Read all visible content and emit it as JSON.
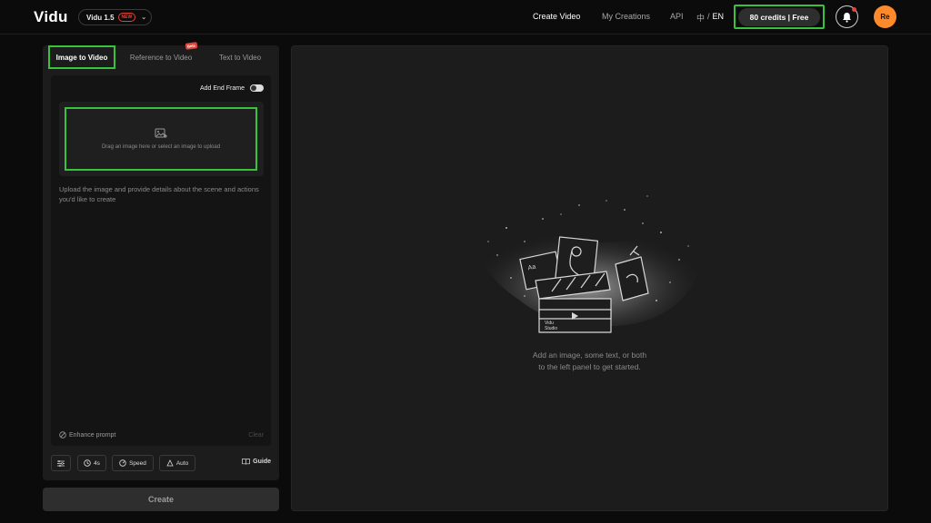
{
  "header": {
    "logo": "Vidu",
    "model": "Vidu 1.5",
    "model_badge": "NEW",
    "nav": {
      "create_video": "Create Video",
      "my_creations": "My Creations",
      "api": "API",
      "lang_zh": "中",
      "lang_sep": "/",
      "lang_en": "EN"
    },
    "credits": "80 credits | Free",
    "avatar": "Re"
  },
  "left_panel": {
    "tabs": [
      "Image to Video",
      "Reference to Video",
      "Text to Video"
    ],
    "beta_badge": "Beta",
    "add_end_frame": "Add End Frame",
    "upload_text": "Drag an image here or select an image to upload",
    "hint": "Upload the image and provide details about the scene and actions you'd like to create",
    "enhance_prompt": "Enhance prompt",
    "clear": "Clear",
    "chips": {
      "duration": "4s",
      "speed": "Speed",
      "auto": "Auto"
    },
    "guide": "Guide",
    "create": "Create"
  },
  "right_panel": {
    "empty_line1": "Add an image, some text, or both",
    "empty_line2": "to the left panel to get started.",
    "clapper_label_1": "Vidu",
    "clapper_label_2": "Studio",
    "card_text": "Aa"
  },
  "colors": {
    "highlight": "#39c23c",
    "avatar": "#ff8a2b",
    "badge": "#e0453a"
  }
}
